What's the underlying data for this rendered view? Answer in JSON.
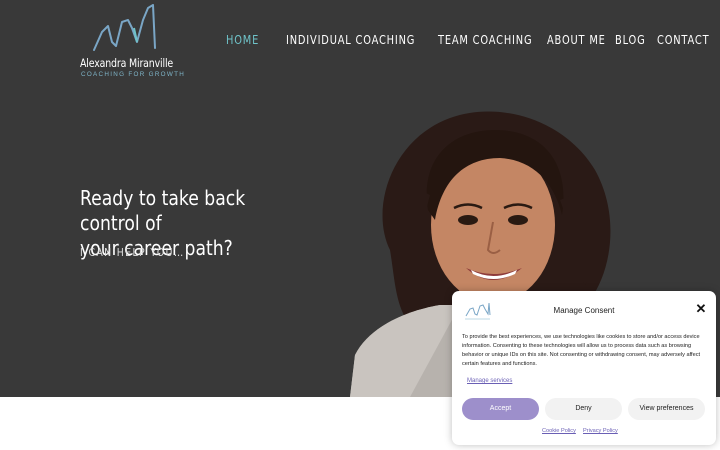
{
  "brand": {
    "name": "Alexandra Miranville",
    "tagline": "COACHING FOR GROWTH",
    "logo_icon": "wave-line-logo-icon",
    "colors": {
      "dark_bg": "#393939",
      "accent_teal": "#6fc3c9",
      "tagline_blue": "#7fb5c9",
      "consent_purple": "#9d8fcb"
    }
  },
  "nav": {
    "items": [
      {
        "label": "HOME",
        "active": true
      },
      {
        "label": "INDIVIDUAL COACHING",
        "active": false
      },
      {
        "label": "TEAM COACHING",
        "active": false
      },
      {
        "label": "ABOUT ME",
        "active": false
      },
      {
        "label": "BLOG",
        "active": false
      },
      {
        "label": "CONTACT",
        "active": false
      }
    ]
  },
  "hero": {
    "headline_line1": "Ready to take back control of",
    "headline_line2": "your career path?",
    "subline": "I CAN HELP YOU…",
    "portrait": "woman-portrait-photo"
  },
  "consent": {
    "title": "Manage Consent",
    "close_icon": "close-icon",
    "body": "To provide the best experiences, we use technologies like cookies to store and/or access device information. Consenting to these technologies will allow us to process data such as browsing behavior or unique IDs on this site. Not consenting or withdrawing consent, may adversely affect certain features and functions.",
    "manage_services": "Manage services",
    "accept_label": "Accept",
    "deny_label": "Deny",
    "view_label": "View preferences",
    "cookie_policy": "Cookie Policy",
    "privacy_policy": "Privacy Policy"
  }
}
